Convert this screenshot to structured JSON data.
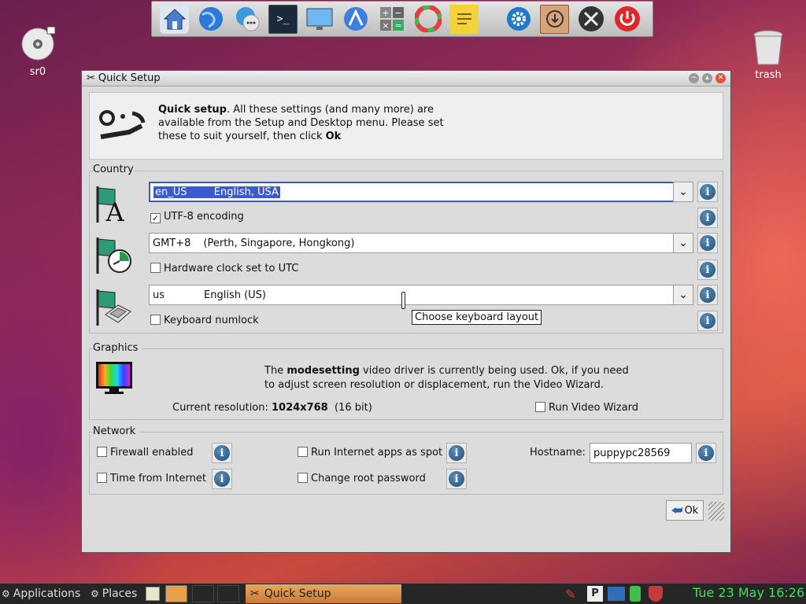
{
  "dock": {
    "icons": [
      "home-icon",
      "globe-browser-icon",
      "chat-icon",
      "terminal-icon",
      "monitor-icon",
      "network-icon",
      "calculator-icon",
      "color-wheel-icon",
      "notes-icon",
      "settings-icon",
      "package-icon",
      "tools-icon",
      "power-icon"
    ]
  },
  "desktop": {
    "sr0_label": "sr0",
    "trash_label": "trash"
  },
  "window": {
    "title": "Quick Setup",
    "intro_bold": "Quick setup",
    "intro_rest_1": ". All these settings (and many more) are",
    "intro_line2": "available from the Setup and Desktop menu. Please set",
    "intro_line3_pre": "these to suit yourself, then click ",
    "intro_line3_bold": "Ok"
  },
  "country": {
    "group_title": "Country",
    "locale_code": "en_US",
    "locale_name": "English, USA",
    "utf8_label": "UTF-8 encoding",
    "utf8_checked": true,
    "tz_code": "GMT+8",
    "tz_name": "(Perth, Singapore, Hongkong)",
    "hwclock_label": "Hardware clock set to UTC",
    "kb_code": "us",
    "kb_name": "English (US)",
    "numlock_label": "Keyboard numlock",
    "tooltip": "Choose keyboard layout"
  },
  "graphics": {
    "group_title": "Graphics",
    "line1_pre": "The ",
    "line1_bold": "modesetting",
    "line1_post": " video driver is currently being used. Ok, if you need",
    "line2": "to adjust screen resolution or displacement, run the Video Wizard.",
    "res_label": "Current resolution: ",
    "res_value": "1024x768",
    "res_depth": "  (16 bit)",
    "wizard_label": "Run Video Wizard"
  },
  "network": {
    "group_title": "Network",
    "firewall_label": "Firewall enabled",
    "timesync_label": "Time from Internet",
    "spot_label": "Run Internet apps as spot",
    "rootpw_label": "Change root password",
    "hostname_label": "Hostname:",
    "hostname_value": "puppypc28569"
  },
  "ok_label": "Ok",
  "taskbar": {
    "applications": "Applications",
    "places": "Places",
    "task_title": "Quick Setup",
    "clock": "Tue 23 May 16:26"
  },
  "colors": {
    "accent_focus": "#3a5ad0",
    "clock_green": "#3ee05a",
    "task_active": "#d9904a"
  }
}
